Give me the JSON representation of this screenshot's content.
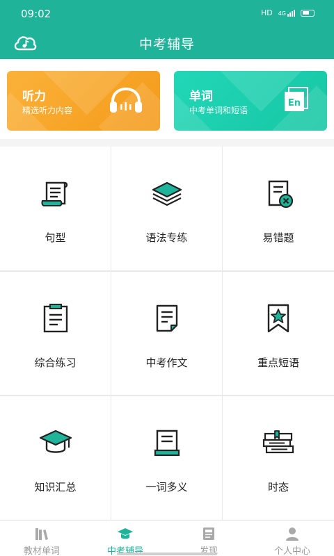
{
  "status": {
    "time": "09:02",
    "network": "HD",
    "signal": "4G"
  },
  "header": {
    "title": "中考辅导"
  },
  "banners": [
    {
      "title": "听力",
      "subtitle": "精选听力内容",
      "icon": "headphones-icon",
      "color": "#f7a21f"
    },
    {
      "title": "单词",
      "subtitle": "中考单词和短语",
      "icon": "en-book-icon",
      "icon_text": "En",
      "color": "#1fceae"
    }
  ],
  "grid": [
    {
      "label": "句型",
      "icon": "scroll-icon"
    },
    {
      "label": "语法专练",
      "icon": "layers-icon"
    },
    {
      "label": "易错题",
      "icon": "wrong-doc-icon"
    },
    {
      "label": "综合练习",
      "icon": "clipboard-icon"
    },
    {
      "label": "中考作文",
      "icon": "document-icon"
    },
    {
      "label": "重点短语",
      "icon": "bookmark-star-icon"
    },
    {
      "label": "知识汇总",
      "icon": "grad-cap-icon"
    },
    {
      "label": "一词多义",
      "icon": "book-icon"
    },
    {
      "label": "时态",
      "icon": "books-stack-icon"
    }
  ],
  "tabs": [
    {
      "label": "教材单词",
      "icon": "bookshelf-icon",
      "active": false
    },
    {
      "label": "中考辅导",
      "icon": "grad-cap-icon",
      "active": true
    },
    {
      "label": "发现",
      "icon": "news-icon",
      "active": false
    },
    {
      "label": "个人中心",
      "icon": "person-icon",
      "active": false
    }
  ],
  "colors": {
    "primary": "#1fb39a",
    "accent_orange": "#f7a21f",
    "accent_teal": "#1fceae",
    "inactive": "#9a9a9a"
  }
}
